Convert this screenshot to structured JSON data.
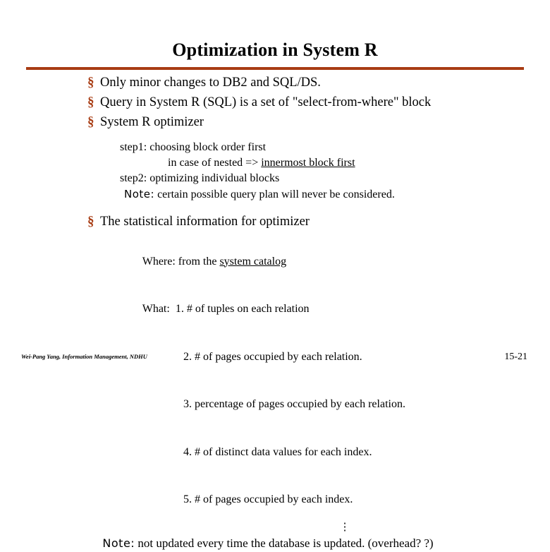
{
  "slide": {
    "title": "Optimization in System R",
    "accent_color": "#A83C13",
    "bullet_glyph": "§",
    "bullets": [
      {
        "text": "Only minor changes to DB2 and SQL/DS."
      },
      {
        "text": "Query in System R (SQL) is a set of \"select-from-where\" block"
      },
      {
        "text": "System R optimizer"
      }
    ],
    "optimizer_details": {
      "step1": "step1: choosing block order first",
      "step1_sub_prefix": "in case of nested => ",
      "step1_sub_underlined": "innermost block first",
      "step2": "step2: optimizing individual blocks",
      "note_label": "Note:",
      "note_text": " certain possible query plan will never be considered."
    },
    "stats_bullet": "The statistical information for optimizer",
    "stats": {
      "where_label": "Where:",
      "where_value_prefix": " from the ",
      "where_value_underlined": "system catalog",
      "what_label": "What:",
      "items": [
        "1. # of tuples on each relation",
        "2. # of pages occupied by each relation.",
        "3. percentage of pages occupied by each relation.",
        "4. # of distinct data values for each index.",
        "5. # of pages occupied by each index."
      ],
      "ellipsis": "⋮"
    },
    "final_note": {
      "label": "Note:",
      "text": " not updated every time the database is updated. (overhead? ?)"
    },
    "footer_left": "Wei-Pang Yang, Information Management, NDHU",
    "footer_right": "15-21"
  }
}
